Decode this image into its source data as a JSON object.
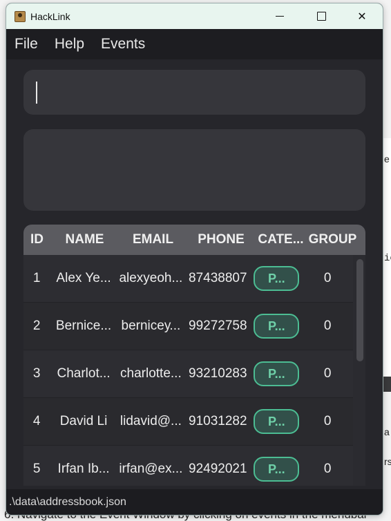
{
  "window": {
    "title": "HackLink",
    "controls": {
      "minimize_icon": "minimize-icon",
      "maximize_icon": "maximize-icon",
      "close_glyph": "✕"
    }
  },
  "menu": [
    "File",
    "Help",
    "Events"
  ],
  "command_input": {
    "value": ""
  },
  "result_display": {
    "text": ""
  },
  "table": {
    "columns": [
      "ID",
      "NAME",
      "EMAIL",
      "PHONE",
      "CATE...",
      "GROUP"
    ],
    "rows": [
      {
        "id": "1",
        "name": "Alex Ye...",
        "email": "alexyeoh...",
        "phone": "87438807",
        "category": "P...",
        "group": "0"
      },
      {
        "id": "2",
        "name": "Bernice...",
        "email": "berniceу...",
        "phone": "99272758",
        "category": "P...",
        "group": "0"
      },
      {
        "id": "3",
        "name": "Charlot...",
        "email": "charlotte...",
        "phone": "93210283",
        "category": "P...",
        "group": "0"
      },
      {
        "id": "4",
        "name": "David Li",
        "email": "lidavid@...",
        "phone": "91031282",
        "category": "P...",
        "group": "0"
      },
      {
        "id": "5",
        "name": "Irfan Ib...",
        "email": "irfan@ex...",
        "phone": "92492021",
        "category": "P...",
        "group": "0"
      }
    ]
  },
  "status_bar": {
    "path": ".\\data\\addressbook.json"
  },
  "background_document": {
    "fragments": [
      "e",
      "ic",
      "a",
      "rs"
    ],
    "bottom_line": "6. Navigate to the Event Window by clicking on events in the menubar"
  },
  "colors": {
    "window_bg": "#26262b",
    "titlebar_bg": "#e8f5ef",
    "accent_green": "#4cbd93",
    "header_bg": "#5b5b60"
  }
}
